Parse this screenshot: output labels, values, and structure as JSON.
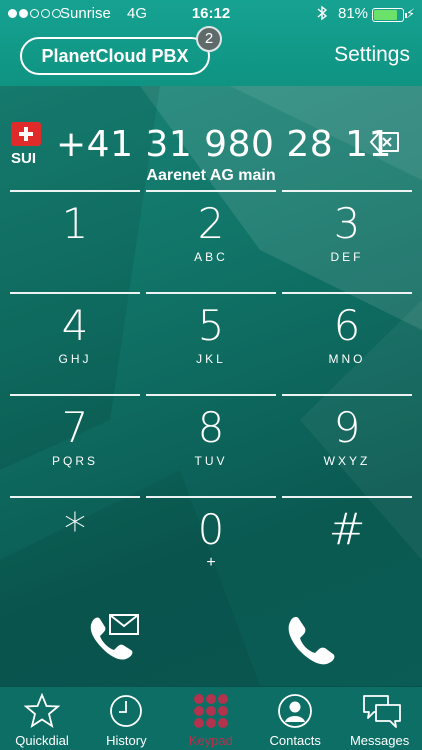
{
  "status_bar": {
    "carrier": "Sunrise",
    "network": "4G",
    "time": "16:12",
    "battery_percent": "81%",
    "battery_level": 0.81,
    "signal_bars": 2,
    "bluetooth_icon": "bluetooth-icon"
  },
  "header": {
    "account_button": "PlanetCloud PBX",
    "badge_count": "2",
    "settings_label": "Settings"
  },
  "dialer": {
    "country_code": "SUI",
    "flag_icon": "swiss-flag-icon",
    "number": "+41 31 980 28 11",
    "contact_name": "Aarenet AG main",
    "backspace_icon": "backspace-icon"
  },
  "keypad": [
    {
      "digit": "1",
      "letters": ""
    },
    {
      "digit": "2",
      "letters": "ABC"
    },
    {
      "digit": "3",
      "letters": "DEF"
    },
    {
      "digit": "4",
      "letters": "GHJ"
    },
    {
      "digit": "5",
      "letters": "JKL"
    },
    {
      "digit": "6",
      "letters": "MNO"
    },
    {
      "digit": "7",
      "letters": "PQRS"
    },
    {
      "digit": "8",
      "letters": "TUV"
    },
    {
      "digit": "9",
      "letters": "WXYZ"
    },
    {
      "digit": "*",
      "letters": ""
    },
    {
      "digit": "0",
      "letters": "+"
    },
    {
      "digit": "#",
      "letters": ""
    }
  ],
  "actions": {
    "voicemail_icon": "voicemail-call-icon",
    "call_icon": "phone-call-icon"
  },
  "tabs": [
    {
      "label": "Quickdial",
      "icon": "star-icon",
      "active": false
    },
    {
      "label": "History",
      "icon": "clock-icon",
      "active": false
    },
    {
      "label": "Keypad",
      "icon": "keypad-icon",
      "active": true
    },
    {
      "label": "Contacts",
      "icon": "contact-icon",
      "active": false
    },
    {
      "label": "Messages",
      "icon": "chat-icon",
      "active": false
    }
  ],
  "colors": {
    "accent_active": "#b2334d",
    "header": "#12998a",
    "background": "#0c6f66",
    "battery_fill": "#6be06b"
  }
}
